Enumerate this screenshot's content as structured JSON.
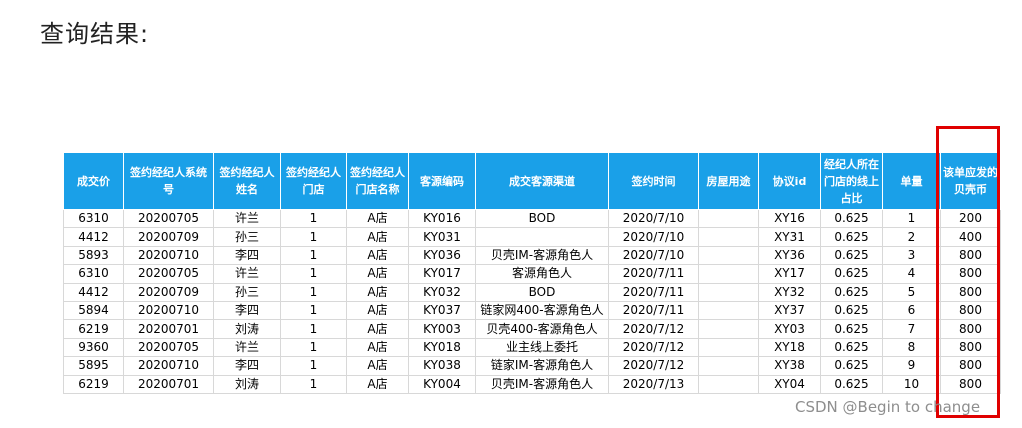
{
  "heading": "查询结果:",
  "table": {
    "columns": [
      "成交价",
      "签约经纪人系统号",
      "签约经纪人姓名",
      "签约经纪人门店",
      "签约经纪人门店名称",
      "客源编码",
      "成交客源渠道",
      "签约时间",
      "房屋用途",
      "协议id",
      "经纪人所在门店的线上占比",
      "单量",
      "该单应发的贝壳币"
    ],
    "rows": [
      [
        "6310",
        "20200705",
        "许兰",
        "1",
        "A店",
        "KY016",
        "BOD",
        "2020/7/10",
        "",
        "XY16",
        "0.625",
        "1",
        "200"
      ],
      [
        "4412",
        "20200709",
        "孙三",
        "1",
        "A店",
        "KY031",
        "",
        "2020/7/10",
        "",
        "XY31",
        "0.625",
        "2",
        "400"
      ],
      [
        "5893",
        "20200710",
        "李四",
        "1",
        "A店",
        "KY036",
        "贝壳IM-客源角色人",
        "2020/7/10",
        "",
        "XY36",
        "0.625",
        "3",
        "800"
      ],
      [
        "6310",
        "20200705",
        "许兰",
        "1",
        "A店",
        "KY017",
        "客源角色人",
        "2020/7/11",
        "",
        "XY17",
        "0.625",
        "4",
        "800"
      ],
      [
        "4412",
        "20200709",
        "孙三",
        "1",
        "A店",
        "KY032",
        "BOD",
        "2020/7/11",
        "",
        "XY32",
        "0.625",
        "5",
        "800"
      ],
      [
        "5894",
        "20200710",
        "李四",
        "1",
        "A店",
        "KY037",
        "链家网400-客源角色人",
        "2020/7/11",
        "",
        "XY37",
        "0.625",
        "6",
        "800"
      ],
      [
        "6219",
        "20200701",
        "刘涛",
        "1",
        "A店",
        "KY003",
        "贝壳400-客源角色人",
        "2020/7/12",
        "",
        "XY03",
        "0.625",
        "7",
        "800"
      ],
      [
        "9360",
        "20200705",
        "许兰",
        "1",
        "A店",
        "KY018",
        "业主线上委托",
        "2020/7/12",
        "",
        "XY18",
        "0.625",
        "8",
        "800"
      ],
      [
        "5895",
        "20200710",
        "李四",
        "1",
        "A店",
        "KY038",
        "链家IM-客源角色人",
        "2020/7/12",
        "",
        "XY38",
        "0.625",
        "9",
        "800"
      ],
      [
        "6219",
        "20200701",
        "刘涛",
        "1",
        "A店",
        "KY004",
        "贝壳IM-客源角色人",
        "2020/7/13",
        "",
        "XY04",
        "0.625",
        "10",
        "800"
      ]
    ]
  },
  "watermark": "CSDN @Begin to change",
  "colors": {
    "header_bg": "#1aa0e8",
    "highlight": "#e00000"
  }
}
